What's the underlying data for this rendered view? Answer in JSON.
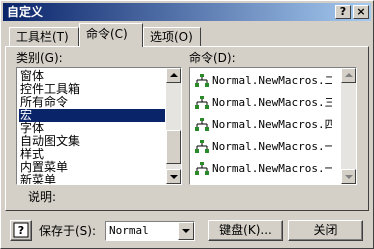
{
  "window": {
    "title": "自定义"
  },
  "titlebar": {
    "help_label": "?",
    "close_label": "×"
  },
  "tabs": [
    {
      "label": "工具栏(T)",
      "active": false
    },
    {
      "label": "命令(C)",
      "active": true
    },
    {
      "label": "选项(O)",
      "active": false
    }
  ],
  "categories": {
    "label": "类别(G):",
    "items": [
      "窗体",
      "控件工具箱",
      "所有命令",
      "宏",
      "字体",
      "自动图文集",
      "样式",
      "内置菜单",
      "新菜单"
    ],
    "selected_index": 3
  },
  "commands": {
    "label": "命令(D):",
    "items": [
      "Normal.NewMacros.二",
      "Normal.NewMacros.三",
      "Normal.NewMacros.四",
      "Normal.NewMacros.一",
      "Normal.NewMacros.一"
    ],
    "icon": "macro-tree-icon"
  },
  "description": {
    "label": "说明:"
  },
  "footer": {
    "save_in_label": "保存于(S):",
    "save_in_value": "Normal",
    "keyboard_button": "键盘(K)...",
    "close_button": "关闭"
  },
  "colors": {
    "title_start": "#0a246a",
    "title_end": "#a6caf0",
    "face": "#d4d0c8",
    "selection": "#0a246a"
  }
}
